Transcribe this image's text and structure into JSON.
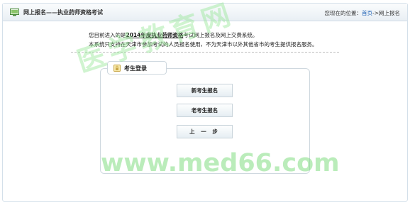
{
  "header": {
    "title": "网上报名——执业药师资格考试",
    "location_prefix": "您现在的位置：",
    "location_home": "首页",
    "location_sep": "->",
    "location_current": "网上报名"
  },
  "intro": {
    "line1_pre": "您目前进入的是",
    "line1_bold": "2014年度执业药师资格",
    "line1_post": "考试网上报名及网上交费系统。",
    "line2": "本系统只支持在天津市参加考试的人员报名使用，不为天津市以外其他省市的考生提供报名服务。"
  },
  "login_panel": {
    "title": "考生登录",
    "new_candidate_button": "新考生报名",
    "returning_candidate_button": "老考生报名",
    "back_button": "上 一 步"
  },
  "watermark": {
    "text_cn": "医学教育网",
    "text_url": "www.med66.com"
  }
}
